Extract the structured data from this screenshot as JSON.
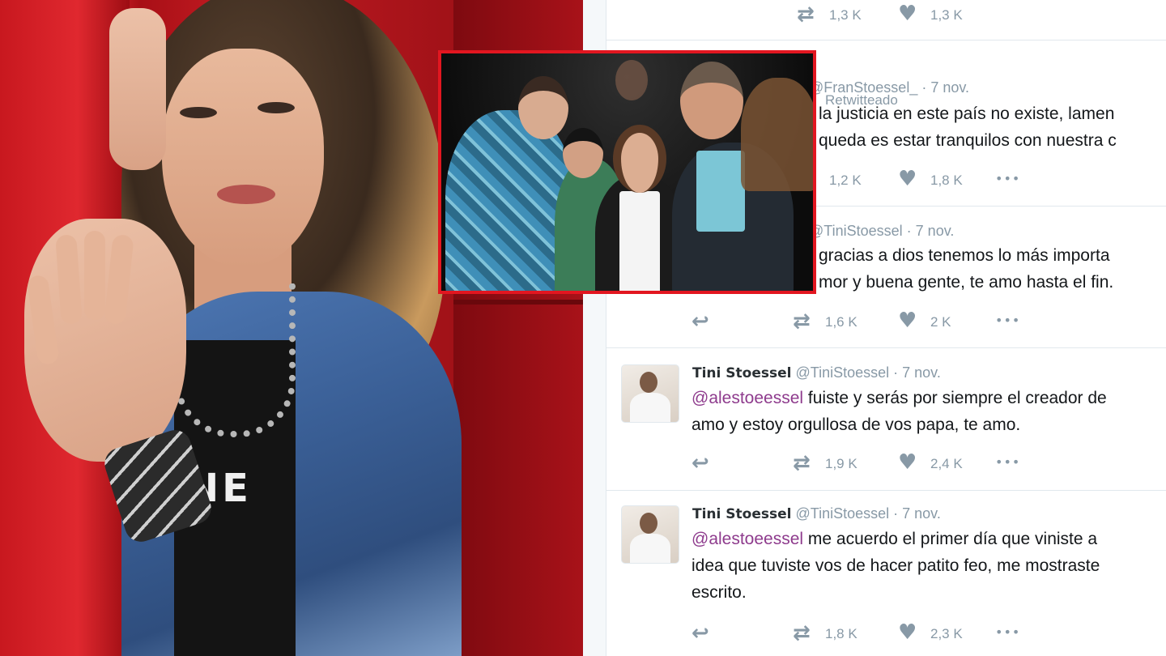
{
  "inset_photo": {
    "description_icon": "family-photo"
  },
  "portrait": {
    "shirt_text": "NE"
  },
  "timeline": {
    "top_stub": {
      "retweets": "1,3 K",
      "likes": "1,3 K"
    },
    "retweet_note": "Retwitteado",
    "tweets": [
      {
        "handle": "@FranStoessel_",
        "date": "· 7 nov.",
        "line1": "la justicia en este país no existe, lamen",
        "line2": "queda es estar tranquilos con nuestra c",
        "retweets": "1,2 K",
        "likes": "1,8 K"
      },
      {
        "handle": "@TiniStoessel",
        "date": "· 7 nov.",
        "line1": "gracias a dios tenemos lo más importa",
        "line2": "mor y buena gente, te amo hasta el fin.",
        "retweets": "1,6 K",
        "likes": "2 K"
      },
      {
        "name": "Tini Stoessel",
        "handle": "@TiniStoessel",
        "date": "· 7 nov.",
        "mention": "@alestoeessel",
        "line1_rest": " fuiste y serás por siempre el creador de",
        "line2": "amo y estoy orgullosa de vos papa, te amo.",
        "retweets": "1,9 K",
        "likes": "2,4 K"
      },
      {
        "name": "Tini Stoessel",
        "handle": "@TiniStoessel",
        "date": "· 7 nov.",
        "mention": "@alestoeessel",
        "line1_rest": " me acuerdo el primer día que viniste a",
        "line2": "idea que tuviste vos de hacer patito feo, me mostraste",
        "line3": "escrito.",
        "retweets": "1,8 K",
        "likes": "2,3 K"
      }
    ]
  },
  "colors": {
    "accent_red": "#e21620",
    "mention": "#8e3b8d",
    "muted": "#8899a6"
  }
}
